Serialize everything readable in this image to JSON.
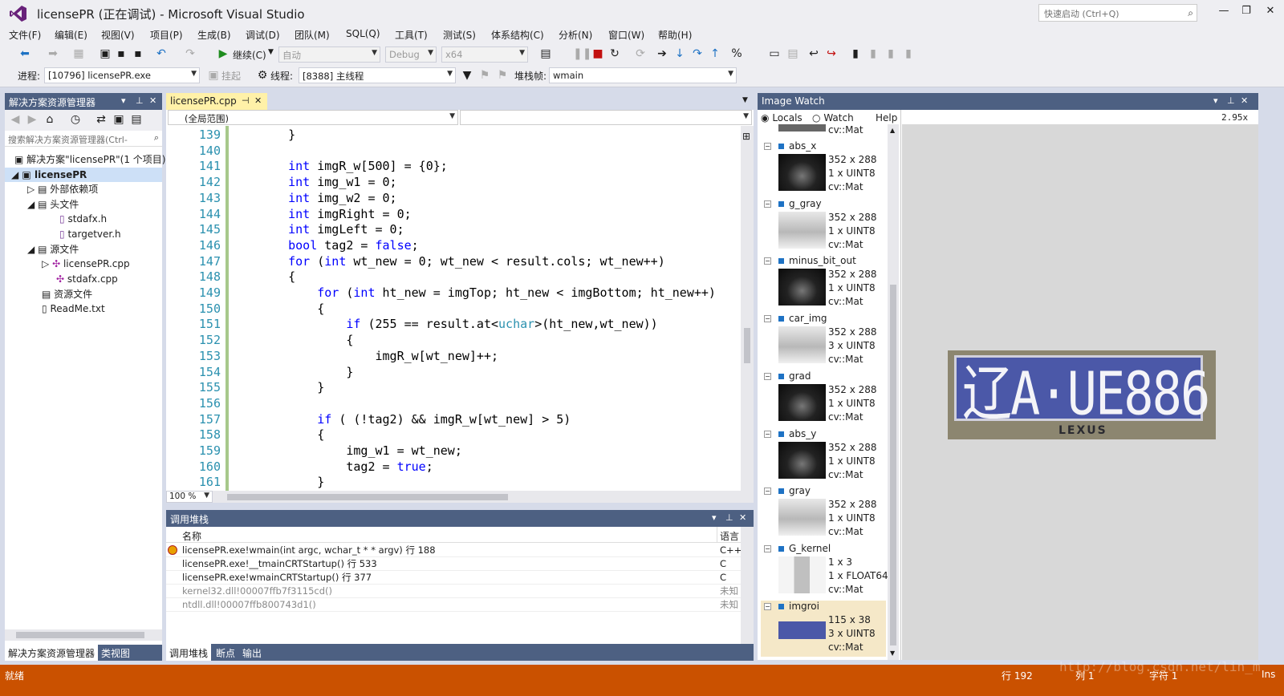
{
  "window": {
    "title": "licensePR (正在调试) - Microsoft Visual Studio",
    "quick_launch_placeholder": "快速启动 (Ctrl+Q)",
    "minimize": "—",
    "restore": "❐",
    "close": "✕"
  },
  "menu": [
    "文件(F)",
    "编辑(E)",
    "视图(V)",
    "项目(P)",
    "生成(B)",
    "调试(D)",
    "团队(M)",
    "SQL(Q)",
    "工具(T)",
    "测试(S)",
    "体系结构(C)",
    "分析(N)",
    "窗口(W)",
    "帮助(H)"
  ],
  "toolbar": {
    "continue_label": "继续(C)",
    "config_auto": "自动",
    "config_debug": "Debug",
    "platform": "x64"
  },
  "debugbar": {
    "process_label": "进程:",
    "process_value": "[10796] licensePR.exe",
    "suspend_label": "挂起",
    "thread_label": "线程:",
    "thread_value": "[8388] 主线程",
    "stackframe_label": "堆栈帧:",
    "stackframe_value": "wmain"
  },
  "solution_explorer": {
    "title": "解决方案资源管理器",
    "search_placeholder": "搜索解决方案资源管理器(Ctrl-",
    "tree": [
      {
        "label": "解决方案\"licensePR\"(1 个项目)",
        "expander": "",
        "icon": "▣"
      },
      {
        "label": "licensePR",
        "expander": "◢",
        "icon": "▣"
      },
      {
        "label": "外部依赖项",
        "expander": "▷",
        "icon": "▤"
      },
      {
        "label": "头文件",
        "expander": "◢",
        "icon": "▤"
      },
      {
        "label": "stdafx.h",
        "expander": "",
        "icon": "▯"
      },
      {
        "label": "targetver.h",
        "expander": "",
        "icon": "▯"
      },
      {
        "label": "源文件",
        "expander": "◢",
        "icon": "▤"
      },
      {
        "label": "licensePR.cpp",
        "expander": "▷",
        "icon": "✣"
      },
      {
        "label": "stdafx.cpp",
        "expander": "",
        "icon": "✣"
      },
      {
        "label": "资源文件",
        "expander": "",
        "icon": "▤"
      },
      {
        "label": "ReadMe.txt",
        "expander": "",
        "icon": "▯"
      }
    ],
    "bottom_tabs": [
      "解决方案资源管理器",
      "类视图"
    ]
  },
  "editor": {
    "tab_label": "licensePR.cpp",
    "scope": "(全局范围)",
    "zoom": "100 %",
    "lines": [
      {
        "n": "139",
        "t": "    }"
      },
      {
        "n": "140",
        "t": ""
      },
      {
        "n": "141",
        "t": "    int imgR_w[500] = {0};"
      },
      {
        "n": "142",
        "t": "    int img_w1 = 0;"
      },
      {
        "n": "143",
        "t": "    int img_w2 = 0;"
      },
      {
        "n": "144",
        "t": "    int imgRight = 0;"
      },
      {
        "n": "145",
        "t": "    int imgLeft = 0;"
      },
      {
        "n": "146",
        "t": "    bool tag2 = false;"
      },
      {
        "n": "147",
        "t": "    for (int wt_new = 0; wt_new < result.cols; wt_new++)"
      },
      {
        "n": "148",
        "t": "    {"
      },
      {
        "n": "149",
        "t": "        for (int ht_new = imgTop; ht_new < imgBottom; ht_new++)"
      },
      {
        "n": "150",
        "t": "        {"
      },
      {
        "n": "151",
        "t": "            if (255 == result.at<uchar>(ht_new,wt_new))"
      },
      {
        "n": "152",
        "t": "            {"
      },
      {
        "n": "153",
        "t": "                imgR_w[wt_new]++;"
      },
      {
        "n": "154",
        "t": "            }"
      },
      {
        "n": "155",
        "t": "        }"
      },
      {
        "n": "156",
        "t": ""
      },
      {
        "n": "157",
        "t": "        if ( (!tag2) && imgR_w[wt_new] > 5)"
      },
      {
        "n": "158",
        "t": "        {"
      },
      {
        "n": "159",
        "t": "            img_w1 = wt_new;"
      },
      {
        "n": "160",
        "t": "            tag2 = true;"
      },
      {
        "n": "161",
        "t": "        }"
      }
    ]
  },
  "callstack": {
    "title": "调用堆栈",
    "col_name": "名称",
    "col_lang": "语言",
    "rows": [
      {
        "name": "licensePR.exe!wmain(int argc, wchar_t * * argv) 行 188",
        "lang": "C++"
      },
      {
        "name": "licensePR.exe!__tmainCRTStartup() 行 533",
        "lang": "C"
      },
      {
        "name": "licensePR.exe!wmainCRTStartup() 行 377",
        "lang": "C"
      },
      {
        "name": "kernel32.dll!00007ffb7f3115cd()",
        "lang": "未知"
      },
      {
        "name": "ntdll.dll!00007ffb800743d1()",
        "lang": "未知"
      }
    ],
    "bottom_tabs": [
      "调用堆栈",
      "断点",
      "输出"
    ]
  },
  "image_watch": {
    "title": "Image Watch",
    "locals": "Locals",
    "watch": "Watch",
    "help": "Help",
    "zoom": "2.95x",
    "top_partial": "cv::Mat",
    "plate_text": "辽A·UE886",
    "plate_brand": "LEXUS",
    "items": [
      {
        "name": "abs_x",
        "size": "352 x 288",
        "ch": "1 x UINT8",
        "type": "cv::Mat",
        "thumb": "dark"
      },
      {
        "name": "g_gray",
        "size": "352 x 288",
        "ch": "1 x UINT8",
        "type": "cv::Mat",
        "thumb": "light"
      },
      {
        "name": "minus_bit_out",
        "size": "352 x 288",
        "ch": "1 x UINT8",
        "type": "cv::Mat",
        "thumb": "dark"
      },
      {
        "name": "car_img",
        "size": "352 x 288",
        "ch": "3 x UINT8",
        "type": "cv::Mat",
        "thumb": "light"
      },
      {
        "name": "grad",
        "size": "352 x 288",
        "ch": "1 x UINT8",
        "type": "cv::Mat",
        "thumb": "dark"
      },
      {
        "name": "abs_y",
        "size": "352 x 288",
        "ch": "1 x UINT8",
        "type": "cv::Mat",
        "thumb": "dark"
      },
      {
        "name": "gray",
        "size": "352 x 288",
        "ch": "1 x UINT8",
        "type": "cv::Mat",
        "thumb": "light"
      },
      {
        "name": "G_kernel",
        "size": "1 x 3",
        "ch": "1 x FLOAT64",
        "type": "cv::Mat",
        "thumb": "kernel"
      },
      {
        "name": "imgroi",
        "size": "115 x 38",
        "ch": "3 x UINT8",
        "type": "cv::Mat",
        "thumb": "plate"
      }
    ]
  },
  "status": {
    "ready": "就绪",
    "line": "行 192",
    "col": "列 1",
    "char": "字符 1",
    "ins": "Ins",
    "watermark": "http://blog.csdn.net/lin_m"
  },
  "colors": {
    "accent": "#ca5100",
    "panel_header": "#4d6082",
    "keyword": "#0000ff",
    "line_number": "#2b91af",
    "tab_active": "#fff1a8"
  }
}
